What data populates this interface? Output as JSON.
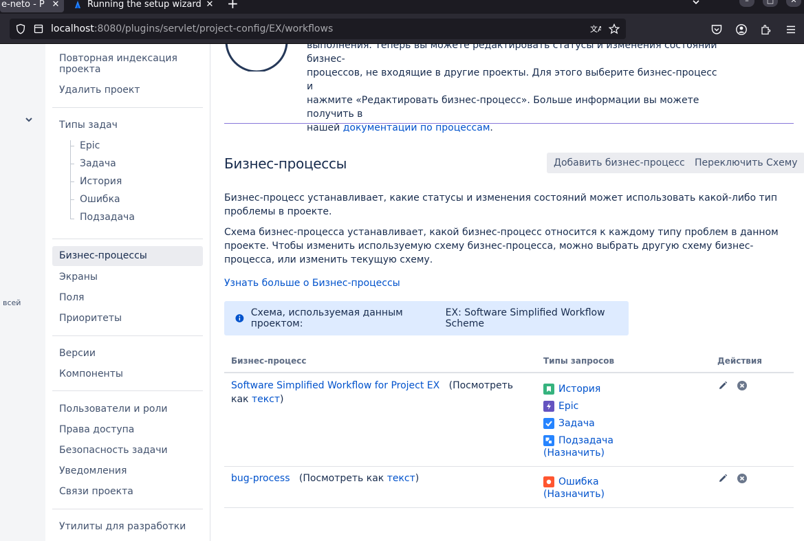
{
  "browser": {
    "tabs": [
      {
        "title": "e-neto - P",
        "active": true
      },
      {
        "title": "Running the setup wizard",
        "active": false
      }
    ],
    "new_tab_label": "+",
    "url_host": "localhost",
    "url_rest": ":8080/plugins/servlet/project-config/EX/workflows"
  },
  "left_strip": {
    "label": "всей"
  },
  "sidebar": {
    "reindex": "Повторная индексация проекта",
    "delete": "Удалить проект",
    "issue_types": "Типы задач",
    "issue_type_items": [
      "Epic",
      "Задача",
      "История",
      "Ошибка",
      "Подзадача"
    ],
    "workflows": "Бизнес-процессы",
    "screens": "Экраны",
    "fields": "Поля",
    "priorities": "Приоритеты",
    "versions": "Версии",
    "components": "Компоненты",
    "users_roles": "Пользователи и роли",
    "permissions": "Права доступа",
    "issue_security": "Безопасность задачи",
    "notifications": "Уведомления",
    "project_links": "Связи проекта",
    "dev_tools": "Утилиты для разработки"
  },
  "main": {
    "intro_line1": "выполнения. Теперь вы можете редактировать статусы и изменения состояний бизнес-",
    "intro_line2": "процессов, не входящие в другие проекты. Для этого выберите бизнес-процесс и",
    "intro_line3": "нажмите «Редактировать бизнес-процесс». Больше информации вы можете получить в",
    "intro_line4_prefix": "нашей",
    "intro_link": "документации по процессам",
    "intro_line4_suffix": ".",
    "title": "Бизнес-процессы",
    "add_button": "Добавить бизнес-процесс",
    "switch_button": "Переключить Схему",
    "desc1": "Бизнес-процесс устанавливает, какие статусы и изменения состояний может использовать какой-либо тип проблемы в проекте.",
    "desc2": "Схема бизнес-процесса устанавливает, какой бизнес-процесс относится к каждому типу проблем в данном проекте. Чтобы изменить используемую схему бизнес-процесса, можно выбрать другую схему бизнес-процесса, или изменить текущую схему.",
    "learn_more": "Узнать больше о Бизнес-процессы",
    "scheme_label": "Схема, используемая данным проектом:",
    "scheme_name": "EX: Software Simplified Workflow Scheme"
  },
  "table": {
    "headers": [
      "Бизнес-процесс",
      "Типы запросов",
      "Действия"
    ],
    "rows": [
      {
        "name": "Software Simplified Workflow for Project EX",
        "view_prefix": "(Посмотреть как",
        "view_link": "текст",
        "view_suffix": ")",
        "types": [
          {
            "label": "История",
            "icon": "story-icon",
            "color": "#36b37e"
          },
          {
            "label": "Epic",
            "icon": "epic-icon",
            "color": "#6554c0"
          },
          {
            "label": "Задача",
            "icon": "task-icon",
            "color": "#2684ff"
          },
          {
            "label": "Подзадача",
            "icon": "subtask-icon",
            "color": "#2684ff"
          }
        ],
        "assign": "(Назначить)"
      },
      {
        "name": "bug-process",
        "view_prefix": "(Посмотреть как",
        "view_link": "текст",
        "view_suffix": ")",
        "types": [
          {
            "label": "Ошибка",
            "icon": "bug-icon",
            "color": "#ff5630"
          }
        ],
        "assign": "(Назначить)"
      }
    ]
  },
  "colors": {
    "link": "#0052cc",
    "info_bg": "#deebff",
    "selected_bg": "#ebecf0"
  }
}
